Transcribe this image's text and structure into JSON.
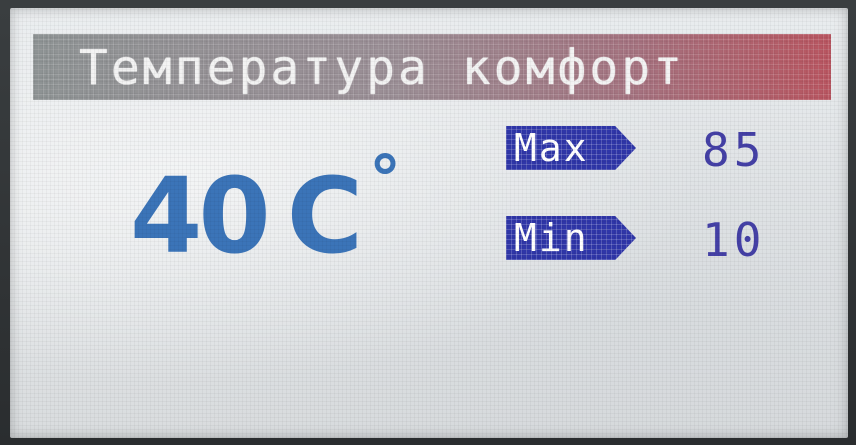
{
  "screen": {
    "title": "Температура комфорт",
    "temperature": {
      "value": "40",
      "unit": "C",
      "degree_symbol": "°"
    },
    "limits": {
      "max": {
        "label": "Max",
        "value": "85"
      },
      "min": {
        "label": "Min",
        "value": "10"
      }
    }
  },
  "colors": {
    "temperature": "#3b74b8",
    "limit_tag": "#2f36a8",
    "limit_value": "#4440a6",
    "title_gradient_start": "#8e9394",
    "title_gradient_end": "#b85560"
  }
}
